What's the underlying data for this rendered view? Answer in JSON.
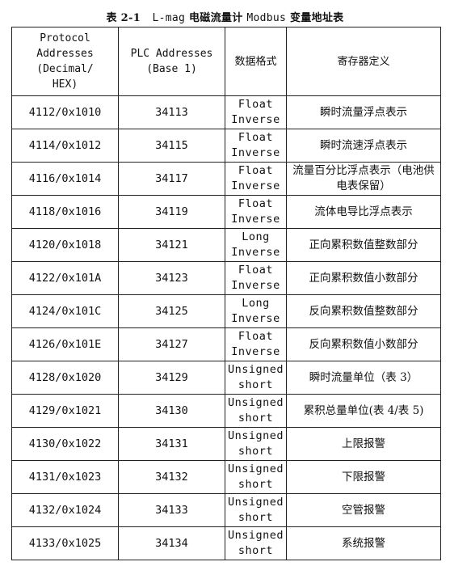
{
  "caption": {
    "prefix": "表 2-1",
    "name": "L-mag",
    "middle": "电磁流量计",
    "protocol": "Modbus",
    "suffix": "变量地址表"
  },
  "table": {
    "headers": [
      [
        "Protocol",
        "Addresses",
        "(Decimal/",
        "HEX)"
      ],
      [
        "PLC Addresses",
        "(Base 1)"
      ],
      [
        "数据格式"
      ],
      [
        "寄存器定义"
      ]
    ],
    "rows": [
      {
        "protocol_address": "4112/0x1010",
        "plc_address": "34113",
        "format": [
          "Float",
          "Inverse"
        ],
        "definition": "瞬时流量浮点表示"
      },
      {
        "protocol_address": "4114/0x1012",
        "plc_address": "34115",
        "format": [
          "Float",
          "Inverse"
        ],
        "definition": "瞬时流速浮点表示"
      },
      {
        "protocol_address": "4116/0x1014",
        "plc_address": "34117",
        "format": [
          "Float",
          "Inverse"
        ],
        "definition": "流量百分比浮点表示（电池供电表保留）"
      },
      {
        "protocol_address": "4118/0x1016",
        "plc_address": "34119",
        "format": [
          "Float",
          "Inverse"
        ],
        "definition": "流体电导比浮点表示"
      },
      {
        "protocol_address": "4120/0x1018",
        "plc_address": "34121",
        "format": [
          "Long",
          "Inverse"
        ],
        "definition": "正向累积数值整数部分"
      },
      {
        "protocol_address": "4122/0x101A",
        "plc_address": "34123",
        "format": [
          "Float",
          "Inverse"
        ],
        "definition": "正向累积数值小数部分"
      },
      {
        "protocol_address": "4124/0x101C",
        "plc_address": "34125",
        "format": [
          "Long",
          "Inverse"
        ],
        "definition": "反向累积数值整数部分"
      },
      {
        "protocol_address": "4126/0x101E",
        "plc_address": "34127",
        "format": [
          "Float",
          "Inverse"
        ],
        "definition": "反向累积数值小数部分"
      },
      {
        "protocol_address": "4128/0x1020",
        "plc_address": "34129",
        "format": [
          "Unsigned",
          "short"
        ],
        "definition": "瞬时流量单位（表 3）"
      },
      {
        "protocol_address": "4129/0x1021",
        "plc_address": "34130",
        "format": [
          "Unsigned",
          "short"
        ],
        "definition": "累积总量单位(表 4/表 5)"
      },
      {
        "protocol_address": "4130/0x1022",
        "plc_address": "34131",
        "format": [
          "Unsigned",
          "short"
        ],
        "definition": "上限报警"
      },
      {
        "protocol_address": "4131/0x1023",
        "plc_address": "34132",
        "format": [
          "Unsigned",
          "short"
        ],
        "definition": "下限报警"
      },
      {
        "protocol_address": "4132/0x1024",
        "plc_address": "34133",
        "format": [
          "Unsigned",
          "short"
        ],
        "definition": "空管报警"
      },
      {
        "protocol_address": "4133/0x1025",
        "plc_address": "34134",
        "format": [
          "Unsigned",
          "short"
        ],
        "definition": "系统报警"
      }
    ]
  }
}
